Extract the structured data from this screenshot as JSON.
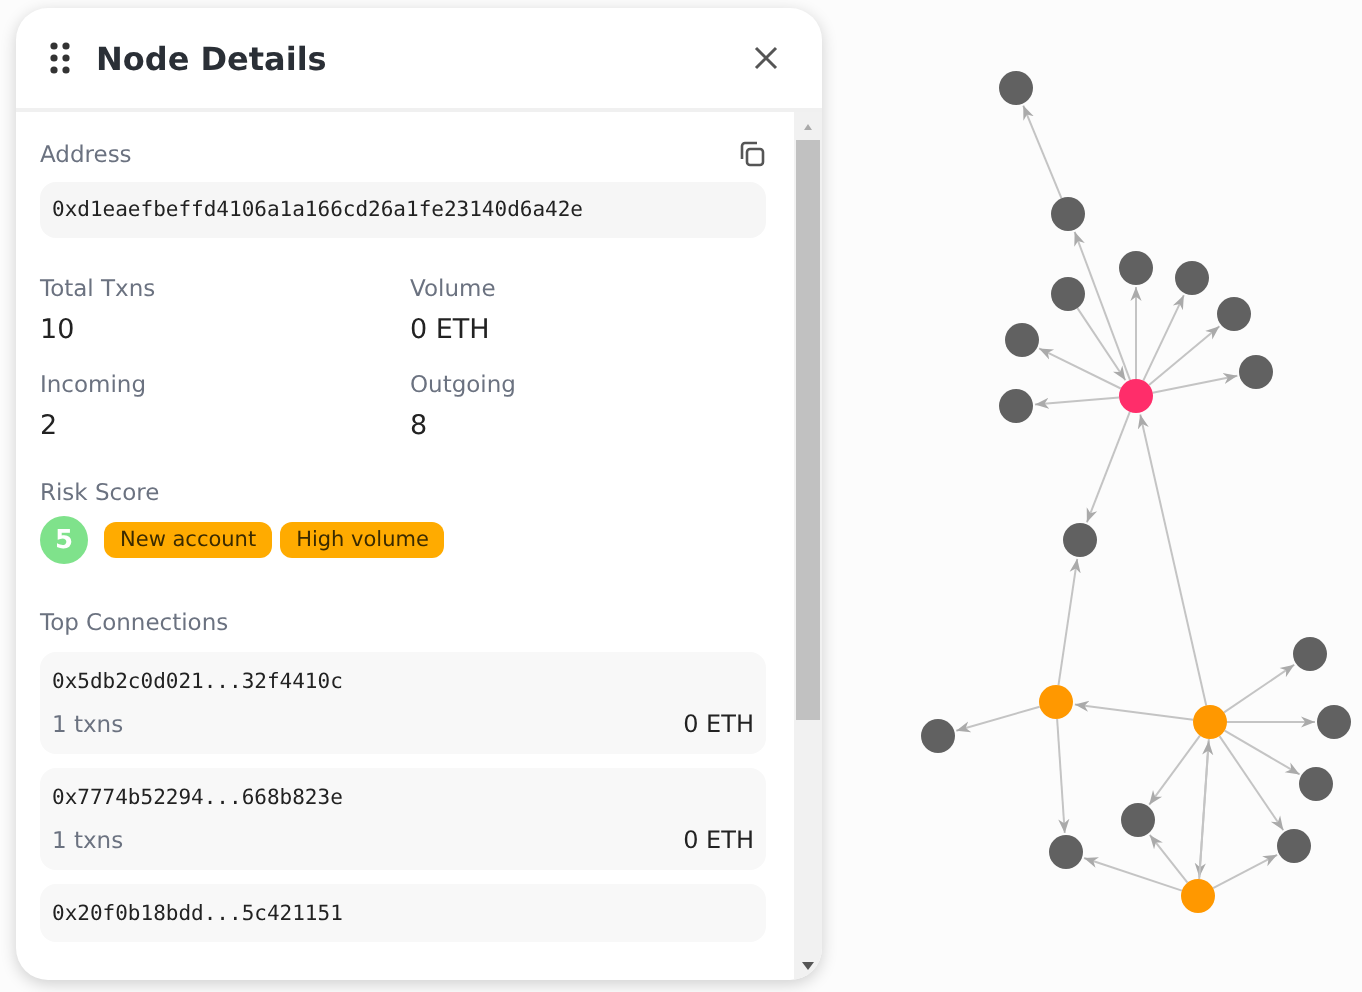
{
  "panel": {
    "title": "Node Details",
    "address_label": "Address",
    "address": "0xd1eaefbeffd4106a1a166cd26a1fe23140d6a42e",
    "stats": [
      {
        "label": "Total Txns",
        "value": "10"
      },
      {
        "label": "Volume",
        "value": "0 ETH"
      },
      {
        "label": "Incoming",
        "value": "2"
      },
      {
        "label": "Outgoing",
        "value": "8"
      }
    ],
    "risk_label": "Risk Score",
    "risk_score": "5",
    "tags": [
      "New account",
      "High volume"
    ],
    "connections_label": "Top Connections",
    "connections": [
      {
        "address": "0x5db2c0d021...32f4410c",
        "txns": "1 txns",
        "volume": "0 ETH"
      },
      {
        "address": "0x7774b52294...668b823e",
        "txns": "1 txns",
        "volume": "0 ETH"
      },
      {
        "address": "0x20f0b18bdd...5c421151"
      }
    ]
  }
}
